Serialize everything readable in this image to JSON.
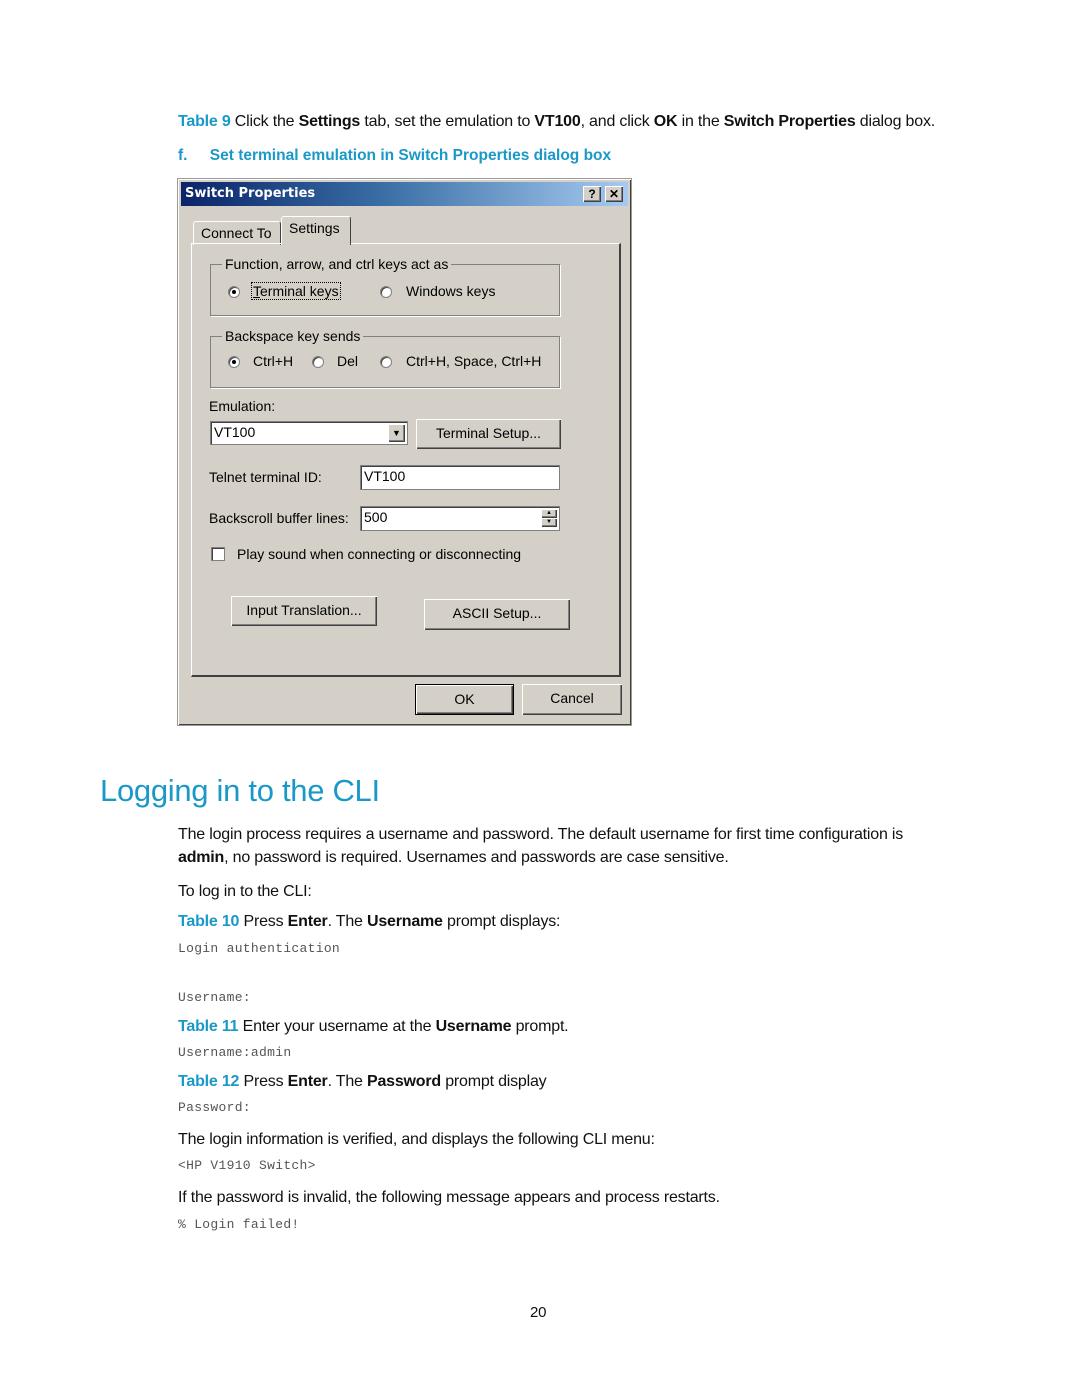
{
  "intro": {
    "table_ref": "Table 9",
    "parts": [
      "Click the ",
      "Settings",
      " tab, set the emulation to ",
      "VT100",
      ", and click ",
      "OK",
      " in the ",
      "Switch Properties",
      " dialog box."
    ]
  },
  "figure_caption": {
    "label": "f.",
    "text": "Set terminal emulation in Switch Properties dialog box"
  },
  "dialog": {
    "title": "Switch Properties",
    "help_button": "?",
    "close_button": "✕",
    "tabs": [
      {
        "label": "Connect To",
        "active": false
      },
      {
        "label": "Settings",
        "active": true
      }
    ],
    "keys_group": {
      "legend": "Function, arrow, and ctrl keys act as",
      "options": [
        {
          "label": "Terminal keys",
          "selected": true
        },
        {
          "label": "Windows keys",
          "selected": false
        }
      ]
    },
    "backspace_group": {
      "legend": "Backspace key sends",
      "options": [
        {
          "label": "Ctrl+H",
          "selected": true
        },
        {
          "label": "Del",
          "selected": false
        },
        {
          "label": "Ctrl+H, Space, Ctrl+H",
          "selected": false
        }
      ]
    },
    "emulation": {
      "label": "Emulation:",
      "value": "VT100",
      "setup_button": "Terminal Setup..."
    },
    "telnet_id": {
      "label": "Telnet terminal ID:",
      "value": "VT100"
    },
    "backscroll": {
      "label": "Backscroll buffer lines:",
      "value": "500"
    },
    "play_sound": {
      "label": "Play sound when connecting or disconnecting",
      "checked": false
    },
    "input_translation_button": "Input Translation...",
    "ascii_setup_button": "ASCII Setup...",
    "ok_button": "OK",
    "cancel_button": "Cancel"
  },
  "section": {
    "title": "Logging in to the CLI",
    "para1_line1": "The login process requires a username and password. The default username for first time configuration is",
    "para1_bold": "admin",
    "para1_line2_rest": ", no password is required. Usernames and passwords are case sensitive.",
    "para2": "To log in to the CLI:",
    "step10": {
      "ref": "Table 10",
      "parts": [
        "Press ",
        "Enter",
        ". The ",
        "Username",
        " prompt displays:"
      ]
    },
    "code10_line1": "Login authentication",
    "code10_line2": "Username:",
    "step11": {
      "ref": "Table 11",
      "parts": [
        "Enter your username at the ",
        "Username",
        " prompt."
      ]
    },
    "code11": "Username:admin",
    "step12": {
      "ref": "Table 12",
      "parts": [
        "Press ",
        "Enter",
        ". The ",
        "Password",
        " prompt display"
      ]
    },
    "code12": "Password:",
    "para3": "The login information is verified, and displays the following CLI menu:",
    "code13": "<HP V1910 Switch>",
    "para4": "If the password is invalid, the following message appears and process restarts.",
    "code14": "% Login failed!"
  },
  "page_number": "20"
}
